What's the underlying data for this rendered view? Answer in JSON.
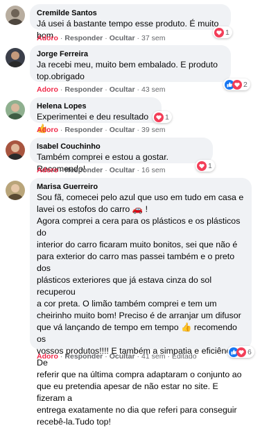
{
  "actions": {
    "like": "Adoro",
    "reply": "Responder",
    "hide": "Ocultar",
    "dot": "·"
  },
  "comments": [
    {
      "author": "Cremilde Santos",
      "lines": [
        "Já usei á bastante tempo esse produto. É muito bom"
      ],
      "time": "37 sem",
      "reaction_count": "1",
      "reactions": [
        "heart-icon"
      ],
      "liked": true,
      "avatar_color": "#9a8f82"
    },
    {
      "author": "Jorge Ferreira",
      "lines": [
        "Ja recebi meu, muito bem embalado. E produto",
        "top.obrigado"
      ],
      "time": "43 sem",
      "reaction_count": "2",
      "reactions": [
        "like-icon",
        "heart-icon"
      ],
      "liked": true,
      "avatar_color": "#5c4a3f"
    },
    {
      "author": "Helena Lopes",
      "lines": [
        "Experimentei e deu resultado 👍"
      ],
      "time": "39 sem",
      "reaction_count": "1",
      "reactions": [
        "heart-icon"
      ],
      "liked": true,
      "avatar_color": "#6d8c6e"
    },
    {
      "author": "Isabel Couchinho",
      "lines": [
        "Também comprei e estou a gostar. Recomendo!"
      ],
      "time": "16 sem",
      "reaction_count": "1",
      "reactions": [
        "heart-icon"
      ],
      "liked": true,
      "avatar_color": "#7a4b3a"
    },
    {
      "author": "Marisa Guerreiro",
      "lines": [
        "Sou fã, comecei pelo azul que uso em tudo em casa e",
        "lavei os estofos do carro 🚗 !",
        "Agora comprei a cera para os plásticos e os plásticos do",
        "interior do carro ficaram muito bonitos, sei que não é",
        "para exterior do carro mas passei também e o preto dos",
        "plásticos exteriores que já estava cinza do sol recuperou",
        "a cor preta. O limão também comprei e tem um",
        "cheirinho muito bom! Preciso é de arranjar um difusor",
        "que vá lançando de tempo em tempo 👍 recomendo os",
        "vossos produtos!!!! E também a simpatia e eficiência! De",
        "referir que na última compra adaptaram o conjunto ao",
        "que eu pretendia apesar de não estar no site. E fizeram a",
        "entrega exatamente no dia que referi para conseguir",
        "recebê-la.Tudo top!"
      ],
      "time": "41 sem",
      "edited": "Editado",
      "reaction_count": "6",
      "reactions": [
        "like-icon",
        "heart-icon"
      ],
      "liked": true,
      "avatar_color": "#8a7a5e"
    }
  ],
  "colors": {
    "heart": "#f33e58",
    "like": "#1877f2",
    "bubble": "#f0f2f5",
    "meta": "#65676b",
    "liked": "#f02849"
  }
}
